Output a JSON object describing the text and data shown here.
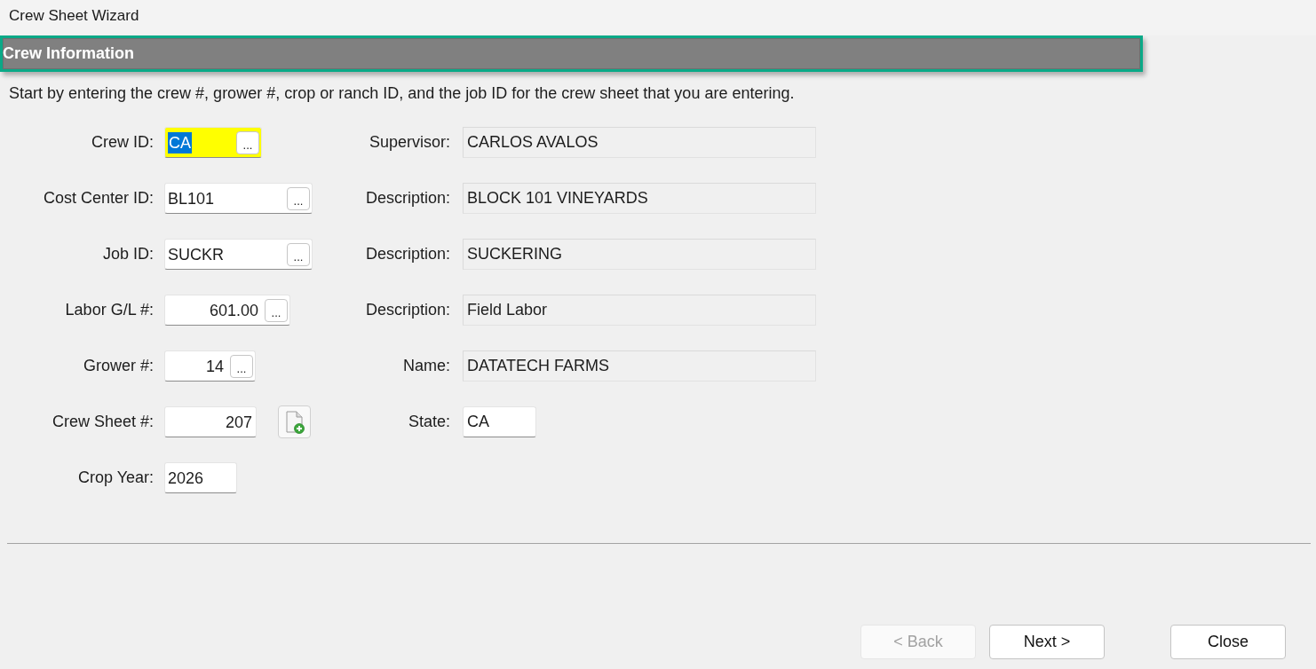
{
  "window": {
    "title": "Crew Sheet Wizard"
  },
  "section": {
    "title": "Crew Information"
  },
  "instructions": "Start by entering the crew #, grower #, crop or ranch ID, and the job ID for the crew sheet that you are entering.",
  "left_fields": [
    {
      "label": "Crew ID:",
      "value": "CA",
      "kind": "lookup",
      "button": "...",
      "focused": true
    },
    {
      "label": "Cost Center ID:",
      "value": "BL101",
      "kind": "lookup",
      "button": "...",
      "focused": false
    },
    {
      "label": "Job ID:",
      "value": "SUCKR",
      "kind": "lookup",
      "button": "...",
      "focused": false
    },
    {
      "label": "Labor G/L #:",
      "value": "601.00",
      "kind": "number_lookup",
      "button": "...",
      "focused": false
    },
    {
      "label": "Grower #:",
      "value": "14",
      "kind": "number_lookup",
      "button": "...",
      "focused": false
    },
    {
      "label": "Crew Sheet #:",
      "value": "207",
      "kind": "number_new",
      "focused": false
    },
    {
      "label": "Crop Year:",
      "value": "2026",
      "kind": "text",
      "focused": false
    }
  ],
  "right_fields": [
    {
      "label": "Supervisor:",
      "value": "CARLOS AVALOS",
      "readonly": true
    },
    {
      "label": "Description:",
      "value": "BLOCK 101 VINEYARDS",
      "readonly": true
    },
    {
      "label": "Description:",
      "value": "SUCKERING",
      "readonly": true
    },
    {
      "label": "Description:",
      "value": "Field Labor",
      "readonly": true
    },
    {
      "label": "Name:",
      "value": "DATATECH FARMS",
      "readonly": true
    },
    {
      "label": "State:",
      "value": "CA",
      "readonly": false
    }
  ],
  "buttons": [
    {
      "label": "< Back",
      "disabled": true
    },
    {
      "label": "Next >",
      "disabled": false
    },
    {
      "label": "Close",
      "disabled": false
    }
  ]
}
